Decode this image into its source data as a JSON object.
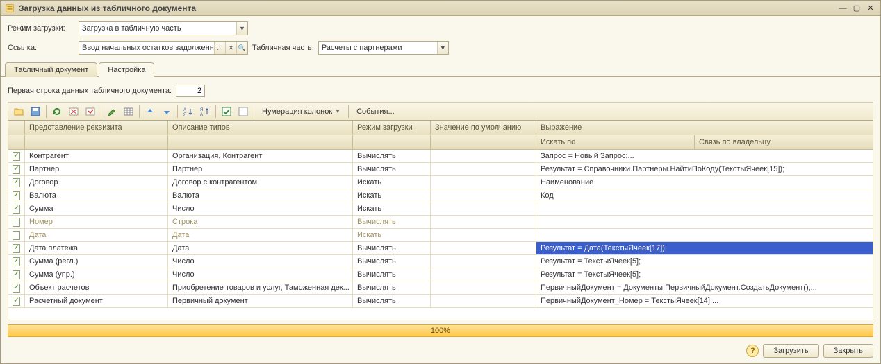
{
  "window": {
    "title": "Загрузка данных из табличного документа"
  },
  "form": {
    "load_mode_label": "Режим загрузки:",
    "load_mode_value": "Загрузка в табличную часть",
    "ref_label": "Ссылка:",
    "ref_value": "Ввод начальных остатков задолженно",
    "tabpart_label": "Табличная часть:",
    "tabpart_value": "Расчеты с партнерами"
  },
  "tabs": {
    "doc": "Табличный документ",
    "settings": "Настройка"
  },
  "tabContent": {
    "first_row_label": "Первая строка данных табличного документа:",
    "first_row_value": "2"
  },
  "toolbar": {
    "numbering": "Нумерация колонок",
    "events": "События..."
  },
  "grid": {
    "headers": {
      "name": "Представление реквизита",
      "types": "Описание типов",
      "loadmode": "Режим загрузки",
      "default": "Значение по умолчанию",
      "expr": "Выражение",
      "searchby": "Искать по",
      "owner": "Связь по владельцу"
    },
    "rows": [
      {
        "checked": true,
        "disabled": false,
        "selected": false,
        "name": "Контрагент",
        "types": "Организация, Контрагент",
        "mode": "Вычислять",
        "default": "",
        "expr": "Запрос = Новый Запрос;...",
        "owner": ""
      },
      {
        "checked": true,
        "disabled": false,
        "selected": false,
        "name": "Партнер",
        "types": "Партнер",
        "mode": "Вычислять",
        "default": "",
        "expr": "Результат = Справочники.Партнеры.НайтиПоКоду(ТекстыЯчеек[15]);",
        "owner": ""
      },
      {
        "checked": true,
        "disabled": false,
        "selected": false,
        "name": "Договор",
        "types": "Договор с контрагентом",
        "mode": "Искать",
        "default": "",
        "expr": "Наименование",
        "owner": ""
      },
      {
        "checked": true,
        "disabled": false,
        "selected": false,
        "name": "Валюта",
        "types": "Валюта",
        "mode": "Искать",
        "default": "",
        "expr": "Код",
        "owner": ""
      },
      {
        "checked": true,
        "disabled": false,
        "selected": false,
        "name": "Сумма",
        "types": "Число",
        "mode": "Искать",
        "default": "",
        "expr": "",
        "owner": ""
      },
      {
        "checked": false,
        "disabled": true,
        "selected": false,
        "name": "Номер",
        "types": "Строка",
        "mode": "Вычислять",
        "default": "",
        "expr": "",
        "owner": ""
      },
      {
        "checked": false,
        "disabled": true,
        "selected": false,
        "name": "Дата",
        "types": "Дата",
        "mode": "Искать",
        "default": "",
        "expr": "",
        "owner": ""
      },
      {
        "checked": true,
        "disabled": false,
        "selected": true,
        "name": "Дата платежа",
        "types": "Дата",
        "mode": "Вычислять",
        "default": "",
        "expr": "Результат             = Дата(ТекстыЯчеек[17]);",
        "owner": ""
      },
      {
        "checked": true,
        "disabled": false,
        "selected": false,
        "name": "Сумма (регл.)",
        "types": "Число",
        "mode": "Вычислять",
        "default": "",
        "expr": "Результат =  ТекстыЯчеек[5];",
        "owner": ""
      },
      {
        "checked": true,
        "disabled": false,
        "selected": false,
        "name": "Сумма (упр.)",
        "types": "Число",
        "mode": "Вычислять",
        "default": "",
        "expr": "Результат =  ТекстыЯчеек[5];",
        "owner": ""
      },
      {
        "checked": true,
        "disabled": false,
        "selected": false,
        "name": "Объект расчетов",
        "types": "Приобретение товаров и услуг, Таможенная дек...",
        "mode": "Вычислять",
        "default": "",
        "expr": "ПервичныйДокумент = Документы.ПервичныйДокумент.СоздатьДокумент();...",
        "owner": ""
      },
      {
        "checked": true,
        "disabled": false,
        "selected": false,
        "name": "Расчетный документ",
        "types": "Первичный документ",
        "mode": "Вычислять",
        "default": "",
        "expr": "ПервичныйДокумент_Номер = ТекстыЯчеек[14];...",
        "owner": ""
      }
    ]
  },
  "progress": "100%",
  "buttons": {
    "load": "Загрузить",
    "close": "Закрыть"
  }
}
